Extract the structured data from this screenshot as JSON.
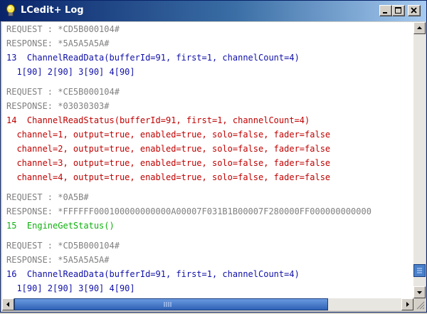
{
  "window": {
    "title": "LCedit+ Log",
    "icon": "lightbulb-icon"
  },
  "colors": {
    "titlebar_start": "#0a246a",
    "titlebar_end": "#a6caf0",
    "request_text": "#808080",
    "command_blue": "#1010a8",
    "command_red": "#c00000",
    "command_green": "#10b010",
    "scrollbar_thumb": "#2f62b5"
  },
  "log": [
    {
      "text": "REQUEST : *CD5B000104#",
      "kind": "request"
    },
    {
      "text": "RESPONSE: *5A5A5A5A#",
      "kind": "response"
    },
    {
      "text": "13  ChannelReadData(bufferId=91, first=1, channelCount=4)",
      "kind": "command-blue"
    },
    {
      "text": "  1[90] 2[90] 3[90] 4[90]",
      "kind": "detail-blue"
    },
    {
      "text": "REQUEST : *CE5B000104#",
      "kind": "request"
    },
    {
      "text": "RESPONSE: *03030303#",
      "kind": "response"
    },
    {
      "text": "14  ChannelReadStatus(bufferId=91, first=1, channelCount=4)",
      "kind": "command-red"
    },
    {
      "text": "  channel=1, output=true, enabled=true, solo=false, fader=false",
      "kind": "detail-red"
    },
    {
      "text": "  channel=2, output=true, enabled=true, solo=false, fader=false",
      "kind": "detail-red"
    },
    {
      "text": "  channel=3, output=true, enabled=true, solo=false, fader=false",
      "kind": "detail-red"
    },
    {
      "text": "  channel=4, output=true, enabled=true, solo=false, fader=false",
      "kind": "detail-red"
    },
    {
      "text": "REQUEST : *0A5B#",
      "kind": "request"
    },
    {
      "text": "RESPONSE: *FFFFFF000100000000000A00007F031B1B00007F280000FF000000000000",
      "kind": "response"
    },
    {
      "text": "15  EngineGetStatus()",
      "kind": "command-green"
    },
    {
      "text": "REQUEST : *CD5B000104#",
      "kind": "request"
    },
    {
      "text": "RESPONSE: *5A5A5A5A#",
      "kind": "response"
    },
    {
      "text": "16  ChannelReadData(bufferId=91, first=1, channelCount=4)",
      "kind": "command-blue"
    },
    {
      "text": "  1[90] 2[90] 3[90] 4[90]",
      "kind": "detail-blue"
    }
  ]
}
